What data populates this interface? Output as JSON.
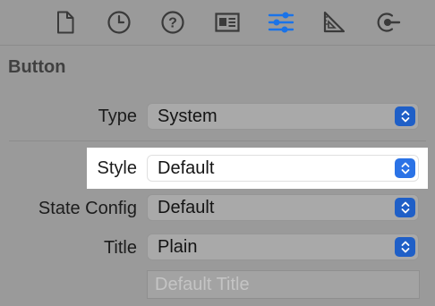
{
  "toolbar": {
    "icons": [
      {
        "name": "file-inspector-icon"
      },
      {
        "name": "history-inspector-icon"
      },
      {
        "name": "quick-help-icon"
      },
      {
        "name": "identity-inspector-icon"
      },
      {
        "name": "attributes-inspector-icon",
        "selected": true
      },
      {
        "name": "size-inspector-icon"
      },
      {
        "name": "connections-inspector-icon"
      }
    ],
    "accent_color": "#1a73e8"
  },
  "section": {
    "title": "Button"
  },
  "rows": {
    "type": {
      "label": "Type",
      "value": "System"
    },
    "style": {
      "label": "Style",
      "value": "Default"
    },
    "state_config": {
      "label": "State Config",
      "value": "Default"
    },
    "title": {
      "label": "Title",
      "value": "Plain"
    }
  },
  "title_field": {
    "placeholder": "Default Title",
    "value": ""
  }
}
